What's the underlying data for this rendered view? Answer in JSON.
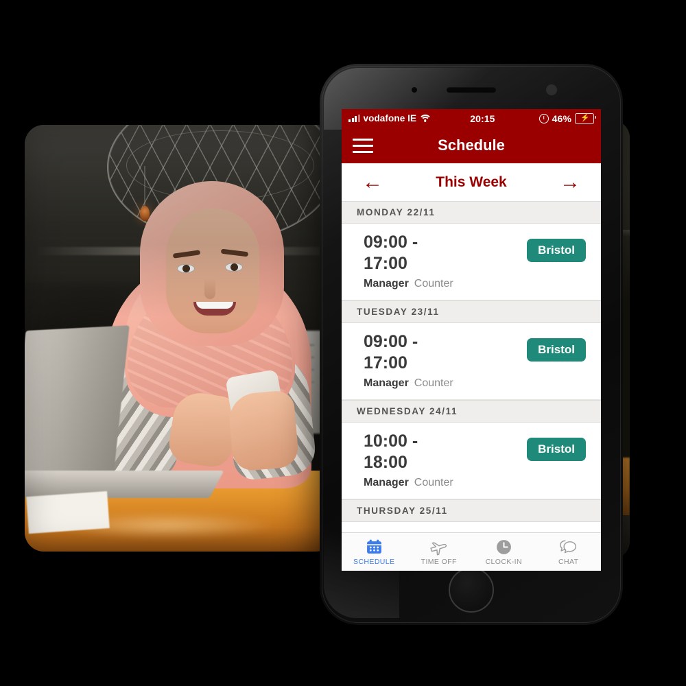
{
  "device": {
    "type": "smartphone-mockup",
    "bezel_color": "#111111"
  },
  "status_bar": {
    "carrier": "vodafone IE",
    "time": "20:15",
    "battery_percent": "46%",
    "signal_icon": "signal-bars-icon",
    "wifi_icon": "wifi-icon",
    "lock_icon": "rotation-lock-icon",
    "battery_icon": "battery-charging-icon",
    "background": "#9a0000",
    "battery_fill_color": "#39d353"
  },
  "app_bar": {
    "menu_icon": "hamburger-menu-icon",
    "title": "Schedule",
    "background": "#9a0000",
    "text_color": "#ffffff"
  },
  "week_nav": {
    "prev_icon": "arrow-left-icon",
    "label": "This Week",
    "next_icon": "arrow-right-icon",
    "accent": "#9a0000"
  },
  "schedule": {
    "badge_color": "#1f8a7a",
    "days": [
      {
        "day_label": "MONDAY 22/11",
        "start_time": "09:00 -",
        "end_time": "17:00",
        "role": "Manager",
        "area": "Counter",
        "location": "Bristol"
      },
      {
        "day_label": "TUESDAY 23/11",
        "start_time": "09:00 -",
        "end_time": "17:00",
        "role": "Manager",
        "area": "Counter",
        "location": "Bristol"
      },
      {
        "day_label": "WEDNESDAY 24/11",
        "start_time": "10:00 -",
        "end_time": "18:00",
        "role": "Manager",
        "area": "Counter",
        "location": "Bristol"
      },
      {
        "day_label": "THURSDAY 25/11",
        "start_time": "",
        "end_time": "",
        "role": "",
        "area": "",
        "location": ""
      }
    ]
  },
  "tab_bar": {
    "active_color": "#3b7df0",
    "inactive_color": "#8e8e8e",
    "items": [
      {
        "label": "SCHEDULE",
        "icon": "calendar-icon",
        "active": true
      },
      {
        "label": "TIME OFF",
        "icon": "airplane-icon",
        "active": false
      },
      {
        "label": "CLOCK-IN",
        "icon": "clock-icon",
        "active": false
      },
      {
        "label": "CHAT",
        "icon": "chat-bubbles-icon",
        "active": false
      }
    ]
  },
  "photos": {
    "front": {
      "description": "Woman in pink hijab using a smartphone at a cafe table with a laptop"
    },
    "back": {
      "description": "Dark cafe bar interior with wooden counter"
    }
  }
}
